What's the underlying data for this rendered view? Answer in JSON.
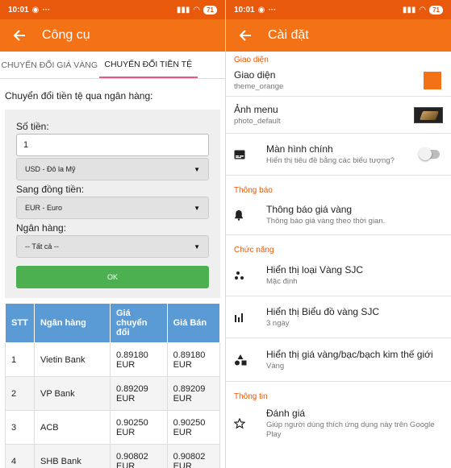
{
  "status": {
    "time": "10:01",
    "battery": "71"
  },
  "left": {
    "title": "Công cụ",
    "tabs": [
      "CHUYỂN ĐỔI GIÁ VÀNG",
      "CHUYỂN ĐỔI TIỀN TỆ"
    ],
    "prompt": "Chuyển đổi tiền tệ qua ngân hàng:",
    "form": {
      "amount_label": "Số tiền:",
      "amount_value": "1",
      "from_currency": "USD - Đô la Mỹ",
      "to_label": "Sang đồng tiền:",
      "to_currency": "EUR - Euro",
      "bank_label": "Ngân hàng:",
      "bank_value": "-- Tất cả --",
      "ok_label": "OK"
    },
    "table": {
      "headers": [
        "STT",
        "Ngân hàng",
        "Giá chuyển đổi",
        "Giá Bán"
      ],
      "rows": [
        [
          "1",
          "Vietin Bank",
          "0.89180 EUR",
          "0.89180 EUR"
        ],
        [
          "2",
          "VP Bank",
          "0.89209 EUR",
          "0.89209 EUR"
        ],
        [
          "3",
          "ACB",
          "0.90250 EUR",
          "0.90250 EUR"
        ],
        [
          "4",
          "SHB Bank",
          "0.90802 EUR",
          "0.90802 EUR"
        ]
      ]
    }
  },
  "right": {
    "title": "Cài đặt",
    "sections": {
      "interface": "Giao diện",
      "notify": "Thông báo",
      "features": "Chức năng",
      "info": "Thông tin"
    },
    "prefs": {
      "theme": {
        "title": "Giao diện",
        "sub": "theme_orange"
      },
      "menu_image": {
        "title": "Ảnh menu",
        "sub": "photo_default"
      },
      "home": {
        "title": "Màn hình chính",
        "sub": "Hiển thị tiêu đề bằng các biểu tượng?"
      },
      "gold_notify": {
        "title": "Thông báo giá vàng",
        "sub": "Thông báo giá vàng theo thời gian."
      },
      "sjc_type": {
        "title": "Hiển thị loại Vàng SJC",
        "sub": "Mặc định"
      },
      "sjc_chart": {
        "title": "Hiển thị Biểu đồ vàng SJC",
        "sub": "3 ngày"
      },
      "world_price": {
        "title": "Hiển thị giá vàng/bạc/bạch kim thế giới",
        "sub": "Vàng"
      },
      "rate": {
        "title": "Đánh giá",
        "sub": "Giúp người dùng thích ứng dụng này trên Google Play"
      }
    }
  },
  "colors": {
    "statusbar": "#e8590c",
    "appbar": "#f47216",
    "ok_button": "#4caf50",
    "table_header": "#5b9bd5"
  }
}
